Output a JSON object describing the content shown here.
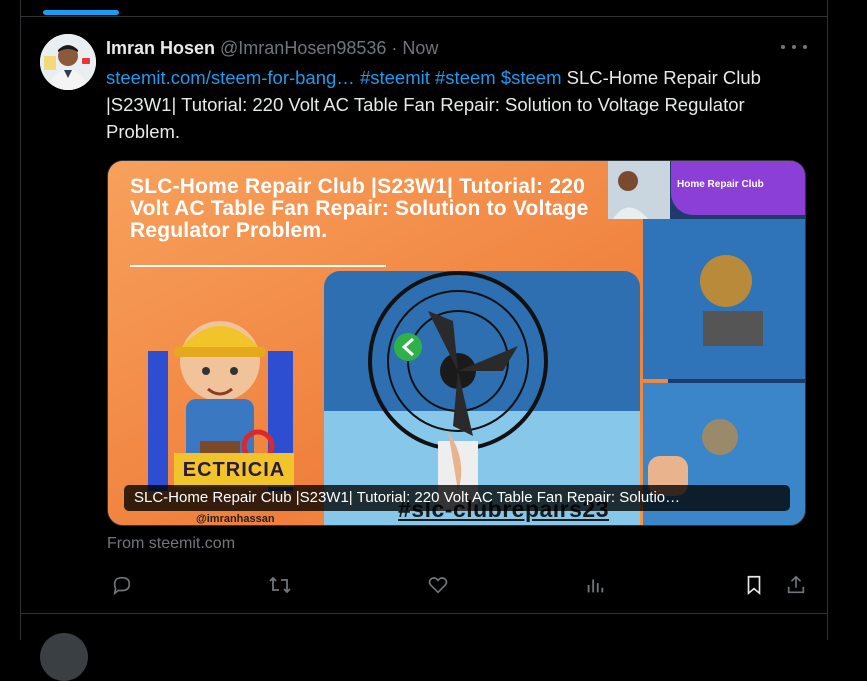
{
  "tweet": {
    "author_name": "Imran Hosen",
    "author_handle": "@ImranHosen98536",
    "separator": "·",
    "time": "Now",
    "text_link": "steemit.com/steem-for-bang…",
    "hashtags": [
      "#steemit",
      "#steem",
      "$steem"
    ],
    "text_body": "SLC-Home Repair Club |S23W1| Tutorial: 220 Volt AC Table Fan Repair: Solution to Voltage Regulator Problem.",
    "card": {
      "image_title": "SLC-Home Repair Club |S23W1| Tutorial: 220 Volt AC Table Fan Repair: Solution to Voltage Regulator Problem.",
      "badge_text": "Home Repair Club",
      "electrician_text": "ECTRICIA",
      "credit_text": "@imranhassan",
      "hashtag_text": "#slc-clubrepairs23",
      "overlay_title": "SLC-Home Repair Club |S23W1| Tutorial: 220 Volt AC Table Fan Repair: Solutio…"
    },
    "source": "From steemit.com",
    "actions": [
      "reply-icon",
      "retweet-icon",
      "like-icon",
      "views-icon",
      "bookmark-icon",
      "share-icon"
    ],
    "colors": {
      "link": "#1d9bf0",
      "text": "#e7e9ea",
      "muted": "#71767b",
      "background": "#000000"
    }
  }
}
